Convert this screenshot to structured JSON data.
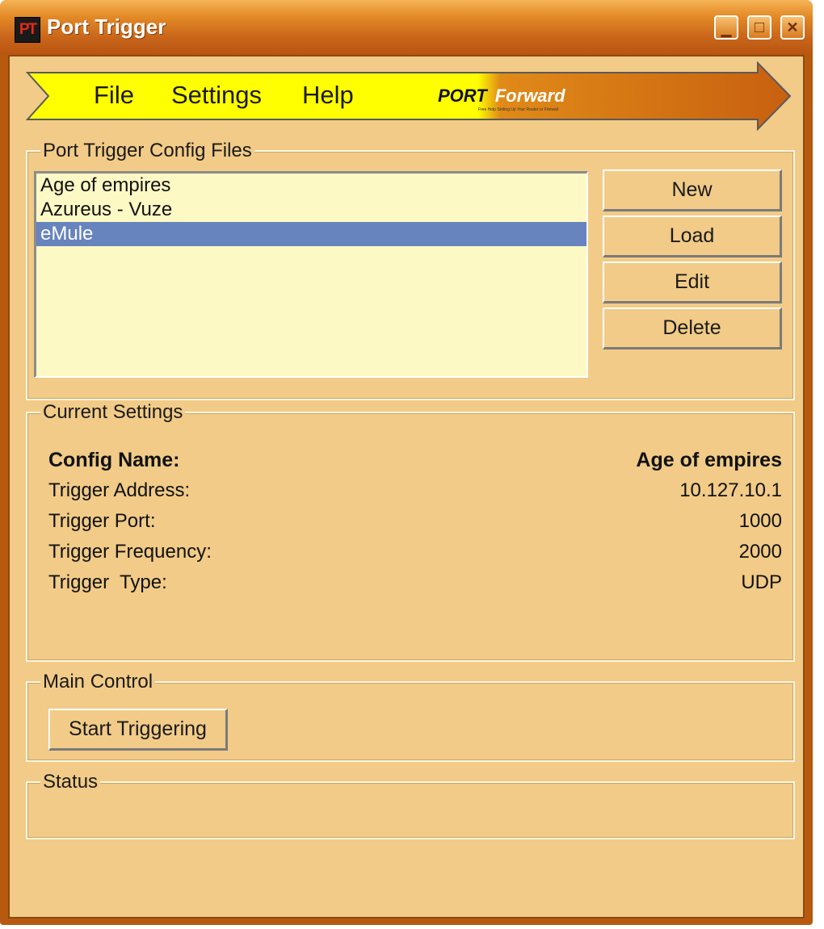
{
  "window": {
    "title": "Port Trigger",
    "icon_text": "PT",
    "controls": {
      "minimize": "▁",
      "maximize": "□",
      "close": "✕"
    }
  },
  "menu": {
    "items": [
      "File",
      "Settings",
      "Help"
    ]
  },
  "banner": {
    "logo_port": "PORT",
    "logo_forward": "Forward",
    "logo_tagline": "Free Help Setting Up Your Router or Firewall"
  },
  "config_files": {
    "legend": "Port Trigger Config Files",
    "items": [
      {
        "label": "Age of empires",
        "selected": false
      },
      {
        "label": "Azureus - Vuze",
        "selected": false
      },
      {
        "label": "eMule",
        "selected": true
      }
    ],
    "buttons": {
      "new": "New",
      "load": "Load",
      "edit": "Edit",
      "delete": "Delete"
    }
  },
  "current_settings": {
    "legend": "Current Settings",
    "config_name": {
      "label": "Config Name:",
      "value": "Age of empires"
    },
    "trigger_address": {
      "label": "Trigger Address:",
      "value": "10.127.10.1"
    },
    "trigger_port": {
      "label": "Trigger Port:",
      "value": "1000"
    },
    "trigger_frequency": {
      "label": "Trigger Frequency:",
      "value": "2000"
    },
    "trigger_type": {
      "label": "Trigger  Type:",
      "value": "UDP"
    }
  },
  "main_control": {
    "legend": "Main Control",
    "start_button": "Start Triggering"
  },
  "status": {
    "legend": "Status",
    "text": ""
  },
  "colors": {
    "body": "#f1cb87",
    "titlebar": "#e38a26",
    "banner_yellow": "#ffff00",
    "banner_orange": "#cc6a10",
    "list_bg": "#fdf9c4",
    "selection": "#6784be"
  }
}
